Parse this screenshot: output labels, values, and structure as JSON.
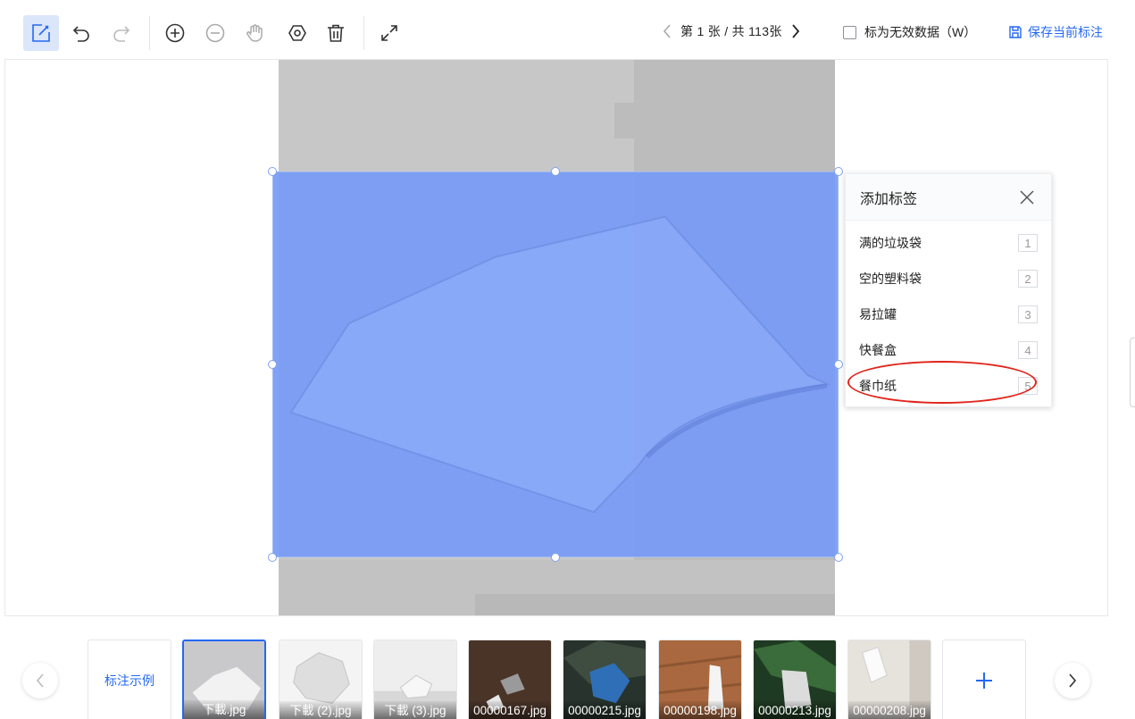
{
  "toolbar": {
    "buttons": [
      {
        "icon": "draw-rect-icon",
        "active": true
      },
      {
        "icon": "undo-icon"
      },
      {
        "icon": "redo-icon"
      },
      {
        "icon": "zoom-in-icon"
      },
      {
        "icon": "zoom-out-icon"
      },
      {
        "icon": "hand-pan-icon"
      },
      {
        "icon": "hexagon-settings-icon"
      },
      {
        "icon": "trash-icon"
      },
      {
        "icon": "fullscreen-icon"
      }
    ],
    "pager": {
      "text": "第 1 张 / 共 113张"
    },
    "invalid_label": "标为无效数据（W）",
    "save_label": "保存当前标注"
  },
  "popup": {
    "title": "添加标签",
    "items": [
      {
        "label": "满的垃圾袋",
        "key": "1"
      },
      {
        "label": "空的塑料袋",
        "key": "2"
      },
      {
        "label": "易拉罐",
        "key": "3"
      },
      {
        "label": "快餐盒",
        "key": "4"
      },
      {
        "label": "餐巾纸",
        "key": "5"
      }
    ]
  },
  "strip": {
    "example_label": "标注示例",
    "thumbs": [
      {
        "name": "下載.jpg",
        "selected": true
      },
      {
        "name": "下載 (2).jpg"
      },
      {
        "name": "下載 (3).jpg"
      },
      {
        "name": "00000167.jpg"
      },
      {
        "name": "00000215.jpg"
      },
      {
        "name": "00000198.jpg"
      },
      {
        "name": "00000213.jpg"
      },
      {
        "name": "00000208.jpg"
      }
    ]
  },
  "colors": {
    "accent": "#2468f2",
    "bbox_fill": "#769af5",
    "highlight_ring": "#e0251b"
  }
}
